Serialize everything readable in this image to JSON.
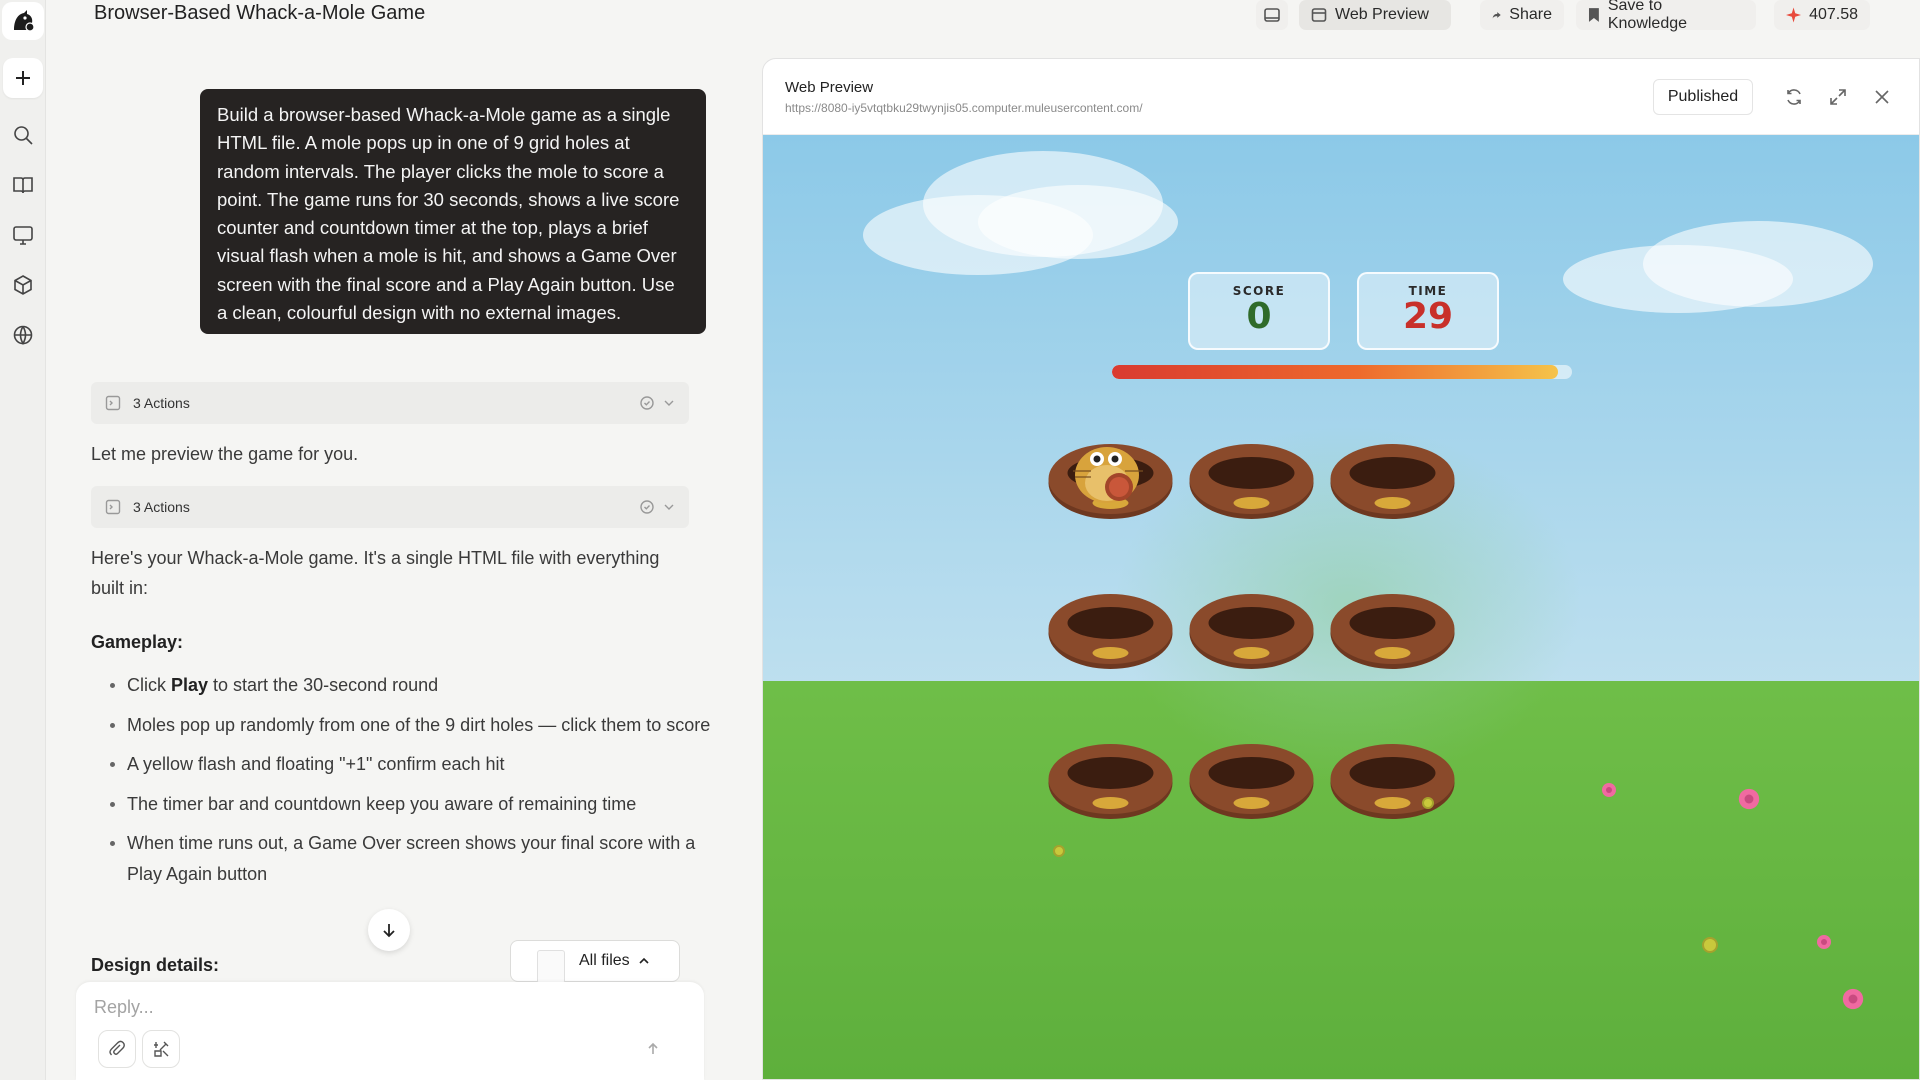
{
  "app": {
    "title": "Browser-Based Whack-a-Mole Game"
  },
  "topbar": {
    "web_preview_label": "Web Preview",
    "share_label": "Share",
    "save_label": "Save to Knowledge",
    "credits": "407.58"
  },
  "chat": {
    "user_message": "Build a browser-based Whack-a-Mole game as a single HTML file. A mole pops up in one of 9 grid holes at random intervals. The player clicks the mole to score a point. The game runs for 30 seconds, shows a live score counter and countdown timer at the top, plays a brief visual flash when a mole is hit, and shows a Game Over screen with the final score and a Play Again button. Use a clean, colourful design with no external images.",
    "actions_1": "3 Actions",
    "preview_text": "Let me preview the game for you.",
    "actions_2": "3 Actions",
    "intro": "Here's your Whack-a-Mole game. It's a single HTML file with everything built in:",
    "gameplay_heading": "Gameplay:",
    "bullets": [
      {
        "pre": "Click ",
        "bold": "Play",
        "post": " to start the 30-second round"
      },
      {
        "pre": "Moles pop up randomly from one of the 9 dirt holes — click them to score",
        "bold": "",
        "post": ""
      },
      {
        "pre": "A yellow flash and floating \"+1\" confirm each hit",
        "bold": "",
        "post": ""
      },
      {
        "pre": "The timer bar and countdown keep you aware of remaining time",
        "bold": "",
        "post": ""
      },
      {
        "pre": "When time runs out, a Game Over screen shows your final score with a Play Again button",
        "bold": "",
        "post": ""
      }
    ],
    "design_heading": "Design details:",
    "all_files_label": "All files",
    "reply_placeholder": "Reply..."
  },
  "preview": {
    "title": "Web Preview",
    "url": "https://8080-iy5vtqtbku29twynjis05.computer.muleusercontent.com/",
    "published_label": "Published"
  },
  "game": {
    "score_label": "SCORE",
    "score_value": "0",
    "time_label": "TIME",
    "time_value": "29",
    "time_remaining_fraction": 0.97,
    "mole_hole_index": 0,
    "colors": {
      "score": "#2f6b2a",
      "time": "#c8302a",
      "sky": "#8cc9e8",
      "grass": "#6fbe48",
      "dirt": "#7a3f24"
    }
  },
  "icons": {
    "logo": "mascot-logo-icon",
    "new": "plus-icon",
    "nav": [
      "search-icon",
      "book-icon",
      "monitor-icon",
      "cube-icon",
      "globe-icon"
    ]
  }
}
